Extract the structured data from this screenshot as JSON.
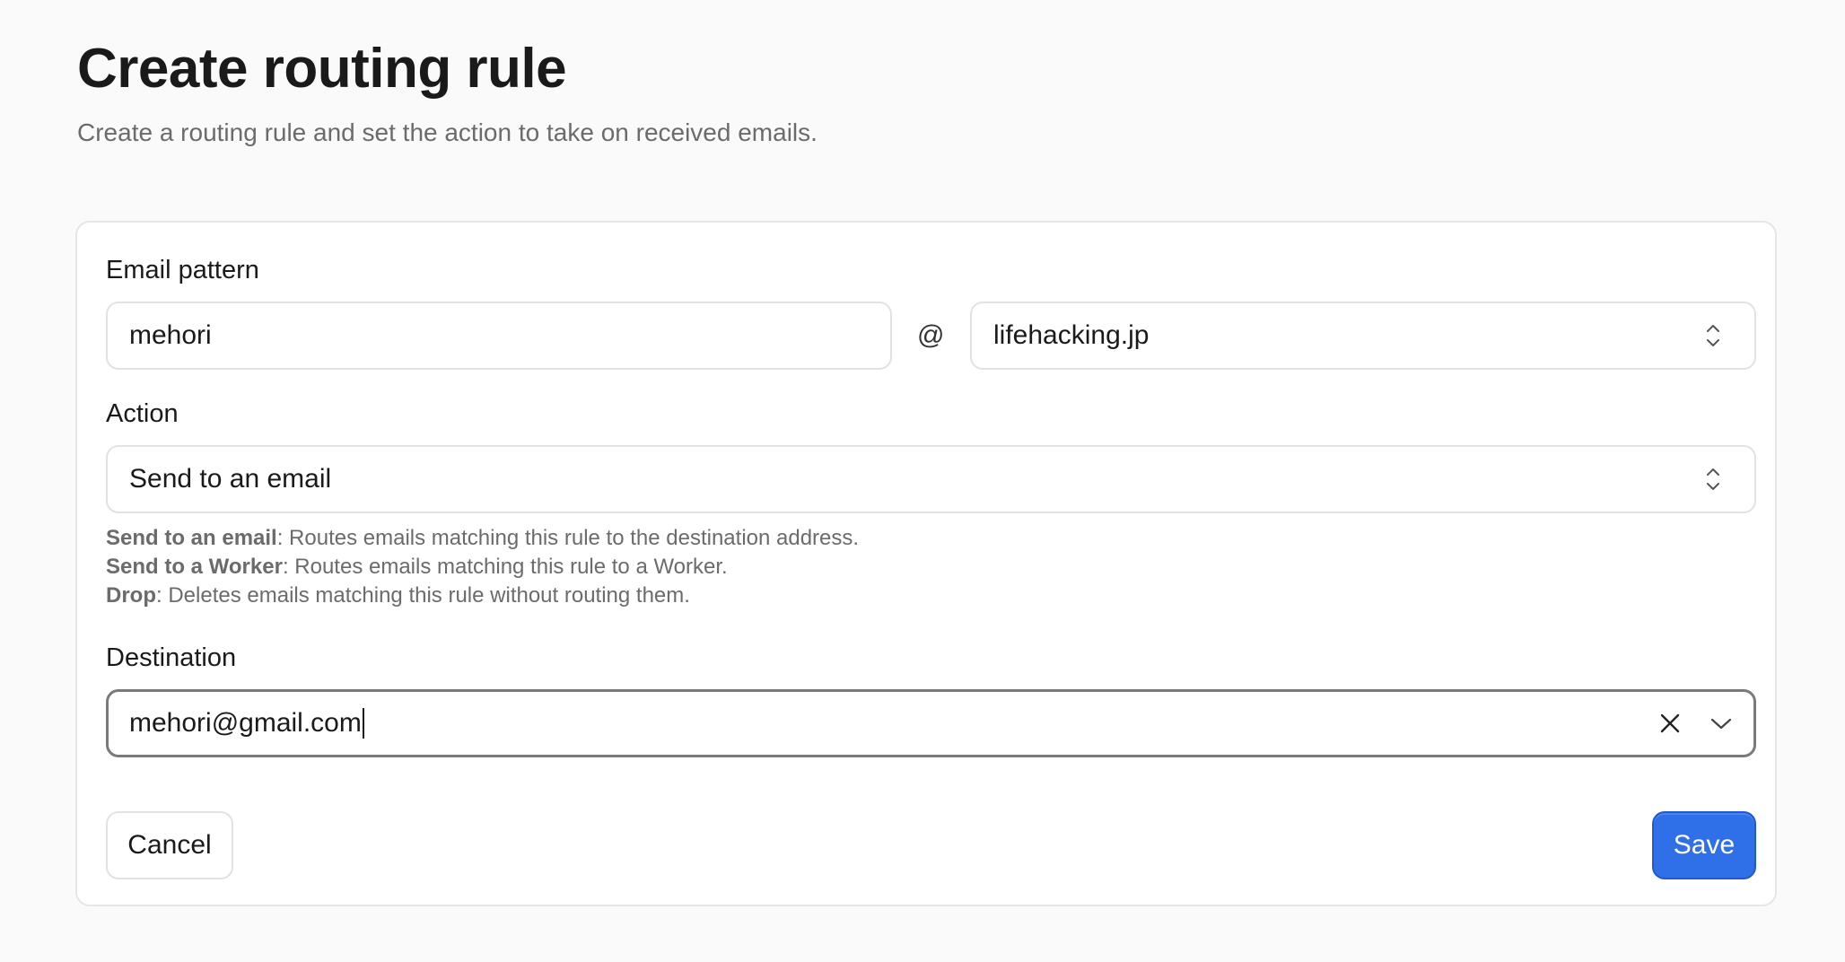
{
  "header": {
    "title": "Create routing rule",
    "subtitle": "Create a routing rule and set the action to take on received emails."
  },
  "form": {
    "email_pattern": {
      "label": "Email pattern",
      "local_part": "mehori",
      "at_symbol": "@",
      "domain": "lifehacking.jp"
    },
    "action": {
      "label": "Action",
      "selected": "Send to an email",
      "help": [
        {
          "term": "Send to an email",
          "text": ": Routes emails matching this rule to the destination address."
        },
        {
          "term": "Send to a Worker",
          "text": ": Routes emails matching this rule to a Worker."
        },
        {
          "term": "Drop",
          "text": ": Deletes emails matching this rule without routing them."
        }
      ]
    },
    "destination": {
      "label": "Destination",
      "value": "mehori@gmail.com"
    }
  },
  "buttons": {
    "cancel": "Cancel",
    "save": "Save"
  },
  "icons": {
    "domain_select": "updown-chevron-icon",
    "action_select": "updown-chevron-icon",
    "destination_clear": "close-icon",
    "destination_dropdown": "chevron-down-icon"
  },
  "colors": {
    "primary": "#2f6fe8",
    "background": "#fafafa",
    "card": "#ffffff",
    "muted_text": "#6b6b6b"
  }
}
